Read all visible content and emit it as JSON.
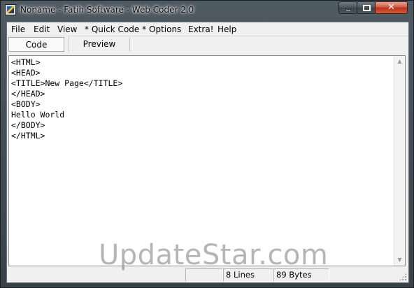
{
  "window": {
    "title": "Noname - Fatih Software - Web Coder 2.0",
    "close_glyph": "✕"
  },
  "menu": {
    "items": [
      "File",
      "Edit",
      "View",
      "* Quick Code *",
      "Options",
      "Extra!",
      "Help"
    ]
  },
  "tabs": {
    "code_label": "Code",
    "preview_label": "Preview",
    "active": "Code"
  },
  "editor": {
    "lines": [
      "<HTML>",
      "<HEAD>",
      "<TITLE>New Page</TITLE>",
      "</HEAD>",
      "<BODY>",
      "Hello World",
      "</BODY>",
      "</HTML>"
    ]
  },
  "status": {
    "empty_panel": "",
    "lines": "8 Lines",
    "bytes": "89 Bytes"
  },
  "watermark": {
    "text": "UpdateStar.com"
  },
  "colors": {
    "title_bar": "#3f4850",
    "close_button": "#c8442b",
    "editor_bg": "#ffffff",
    "chrome_bg": "#f0f0f0"
  }
}
